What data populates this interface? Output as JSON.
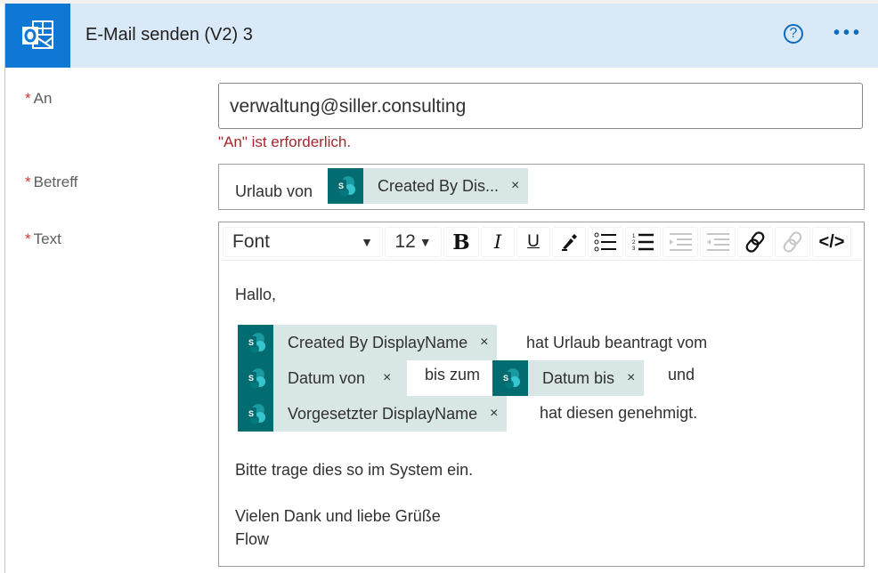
{
  "header": {
    "title": "E-Mail senden (V2) 3",
    "help_icon": "?",
    "more_icon": "•••",
    "accent": "#0f78d4"
  },
  "fields": {
    "to": {
      "label": "An",
      "required": "*",
      "value": "verwaltung@siller.consulting",
      "error": "\"An\" ist erforderlich."
    },
    "subject": {
      "label": "Betreff",
      "required": "*",
      "prefix": "Urlaub von",
      "token": "Created By Dis...",
      "token_remove": "×"
    },
    "body": {
      "label": "Text",
      "required": "*"
    }
  },
  "toolbar": {
    "font": "Font",
    "font_size": "12",
    "bold": "B",
    "italic": "I",
    "underline": "U",
    "code": "</>"
  },
  "editor": {
    "greeting": "Hallo,",
    "token_created_by": "Created By DisplayName",
    "text_requested": "hat Urlaub beantragt vom",
    "token_date_from": "Datum von",
    "text_until": "bis zum",
    "token_date_to": "Datum bis",
    "text_and": "und",
    "token_manager": "Vorgesetzter DisplayName",
    "text_approved": "hat diesen genehmigt.",
    "line_system": "Bitte trage dies so im System ein.",
    "line_thanks": "Vielen Dank und liebe Grüße",
    "line_sign": "Flow",
    "remove": "×"
  }
}
